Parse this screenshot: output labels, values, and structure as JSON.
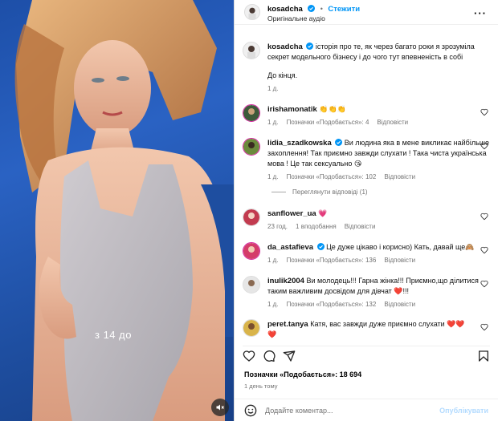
{
  "media": {
    "overlay_text": "з 14 до"
  },
  "header": {
    "username": "kosadcha",
    "separator": "•",
    "follow_label": "Стежити",
    "audio_label": "Оригінальне аудіо"
  },
  "caption": {
    "username": "kosadcha",
    "text": "історія про те, як через багато роки я зрозуміла секрет модельного бізнесу і до чого тут впевненість в собі",
    "text2": "До кінця.",
    "time": "1 д."
  },
  "comments": [
    {
      "username": "irishamonatik",
      "text": "👏👏👏",
      "time": "1 д.",
      "likes": "Позначки «Подобається»: 4",
      "reply": "Відповісти"
    },
    {
      "username": "lidia_szadkowska",
      "text": "Ви людина яка в мене викликає найбільше захоплення! Так приємно завжди слухати ! Така чиста українська мова ! Це так сексуально 😘",
      "time": "1 д.",
      "likes": "Позначки «Подобається»: 102",
      "reply": "Відповісти",
      "view_replies": "Переглянути відповіді (1)"
    },
    {
      "username": "sanflower_ua",
      "text": "💗",
      "time": "23 год.",
      "likes": "1 вподобання",
      "reply": "Відповісти"
    },
    {
      "username": "da_astafieva",
      "text": "Це дуже цікаво і корисно) Кать, давай ще🙈",
      "time": "1 д.",
      "likes": "Позначки «Подобається»: 136",
      "reply": "Відповісти"
    },
    {
      "username": "inulik2004",
      "text": "Ви молодець!!! Гарна жінка!!! Приємно,що ділитися таким важливим досвідом для дівчат ❤️!!!",
      "time": "1 д.",
      "likes": "Позначки «Подобається»: 132",
      "reply": "Відповісти"
    },
    {
      "username": "peret.tanya",
      "text": "Катя, вас завжди дуже приємно слухати ❤️❤️",
      "extra": "❤️"
    }
  ],
  "footer": {
    "likes": "Позначки «Подобається»: 18 694",
    "date": "1 день тому",
    "comment_placeholder": "Додайте коментар...",
    "publish_label": "Опублікувати"
  },
  "icons": {
    "verified_color": "#0095f6",
    "heart_color": "#ed4956"
  }
}
